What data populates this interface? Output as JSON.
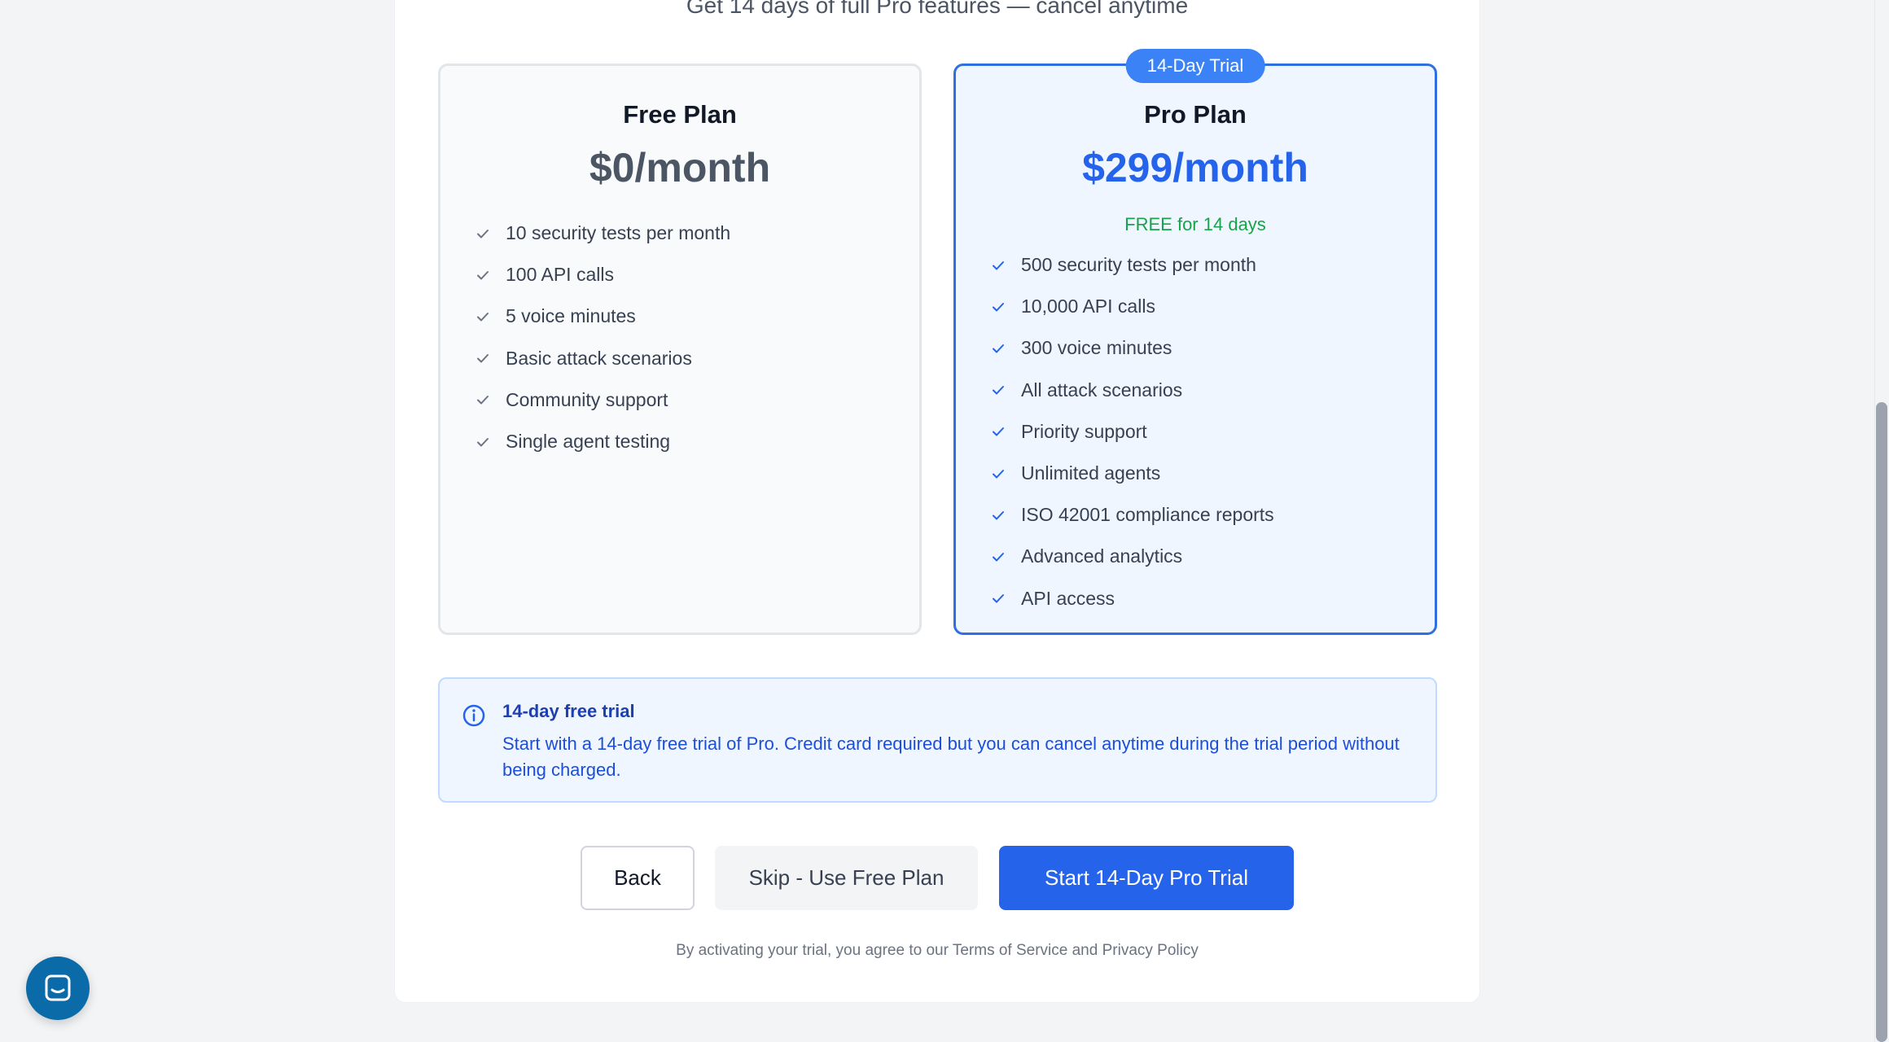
{
  "header": {
    "subtitle": "Get 14 days of full Pro features — cancel anytime"
  },
  "plans": {
    "free": {
      "name": "Free Plan",
      "price": "$0/month",
      "features": [
        "10 security tests per month",
        "100 API calls",
        "5 voice minutes",
        "Basic attack scenarios",
        "Community support",
        "Single agent testing"
      ]
    },
    "pro": {
      "badge": "14-Day Trial",
      "name": "Pro Plan",
      "price": "$299/month",
      "promo": "FREE for 14 days",
      "features": [
        "500 security tests per month",
        "10,000 API calls",
        "300 voice minutes",
        "All attack scenarios",
        "Priority support",
        "Unlimited agents",
        "ISO 42001 compliance reports",
        "Advanced analytics",
        "API access"
      ]
    }
  },
  "info": {
    "icon": "info-icon",
    "title": "14-day free trial",
    "text": "Start with a 14-day free trial of Pro. Credit card required but you can cancel anytime during the trial period without being charged."
  },
  "actions": {
    "back_label": "Back",
    "skip_label": "Skip - Use Free Plan",
    "start_label": "Start 14-Day Pro Trial"
  },
  "legal": "By activating your trial, you agree to our Terms of Service and Privacy Policy",
  "colors": {
    "accent": "#2563eb",
    "promo": "#16a34a",
    "chat": "#0b6aa8"
  },
  "icons": {
    "check": "check-icon",
    "chat": "chat-icon"
  }
}
